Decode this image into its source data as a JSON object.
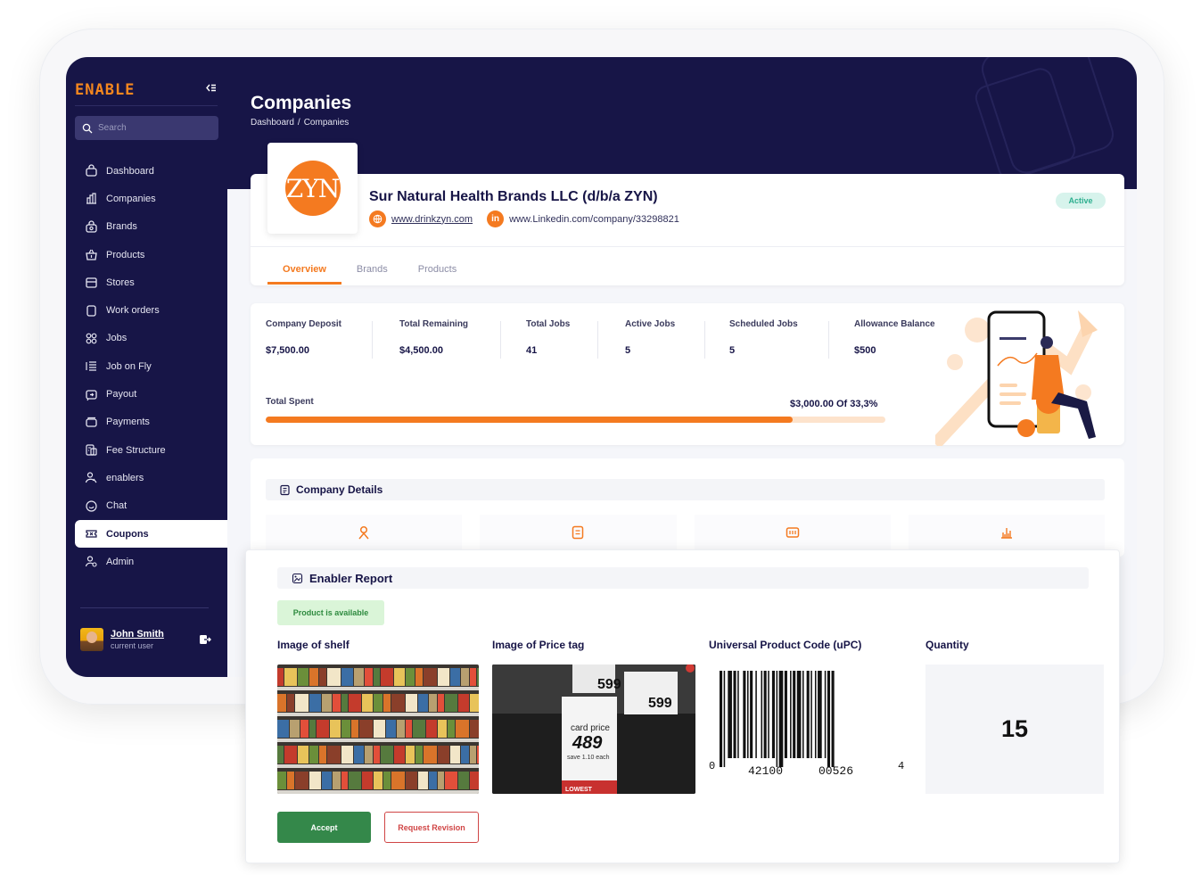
{
  "app": {
    "logo": "ENABLE"
  },
  "colors": {
    "navy": "#171547",
    "accent": "#f47a20",
    "success": "#34884a",
    "danger": "#d04545"
  },
  "search": {
    "placeholder": "Search"
  },
  "sidebar": {
    "items": [
      {
        "label": "Dashboard",
        "icon": "dashboard-icon"
      },
      {
        "label": "Companies",
        "icon": "companies-icon"
      },
      {
        "label": "Brands",
        "icon": "brands-icon"
      },
      {
        "label": "Products",
        "icon": "products-icon"
      },
      {
        "label": "Stores",
        "icon": "stores-icon"
      },
      {
        "label": "Work orders",
        "icon": "work-orders-icon"
      },
      {
        "label": "Jobs",
        "icon": "jobs-icon"
      },
      {
        "label": "Job on Fly",
        "icon": "job-on-fly-icon"
      },
      {
        "label": "Payout",
        "icon": "payout-icon"
      },
      {
        "label": "Payments",
        "icon": "payments-icon"
      },
      {
        "label": "Fee Structure",
        "icon": "fee-structure-icon"
      },
      {
        "label": "enablers",
        "icon": "enablers-icon"
      },
      {
        "label": "Chat",
        "icon": "chat-icon"
      },
      {
        "label": "Coupons",
        "icon": "coupons-icon",
        "active": true
      },
      {
        "label": "Admin",
        "icon": "admin-icon"
      }
    ],
    "user": {
      "name": "John Smith",
      "role": "current user"
    }
  },
  "header": {
    "title": "Companies",
    "breadcrumb": [
      "Dashboard",
      "/",
      "Companies"
    ]
  },
  "company": {
    "logo_text": "ZYN",
    "name": "Sur Natural Health Brands LLC (d/b/a ZYN)",
    "website": "www.drinkzyn.com",
    "linkedin": "www.Linkedin.com/company/33298821",
    "status": "Active",
    "tabs": [
      "Overview",
      "Brands",
      "Products"
    ]
  },
  "stats": [
    {
      "label": "Company Deposit",
      "value": "$7,500.00"
    },
    {
      "label": "Total Remaining",
      "value": "$4,500.00"
    },
    {
      "label": "Total Jobs",
      "value": "41"
    },
    {
      "label": "Active Jobs",
      "value": "5"
    },
    {
      "label": "Scheduled Jobs",
      "value": "5"
    },
    {
      "label": "Allowance Balance",
      "value": "$500"
    }
  ],
  "spent": {
    "label": "Total Spent",
    "value": "$3,000.00 Of 33,3%",
    "progress_fraction": 0.85
  },
  "details": {
    "title": "Company Details"
  },
  "report": {
    "title": "Enabler Report",
    "availability": "Product is available",
    "columns": [
      "Image of shelf",
      "Image of Price tag",
      "Universal Product Code (uPC)",
      "Quantity"
    ],
    "price_tag": {
      "price_a": "599",
      "price_b": "599",
      "card_price_label": "card price",
      "card_price": "489",
      "save": "save 1.10 each",
      "footer": "LOWEST"
    },
    "upc": {
      "left": "0",
      "group1": "42100",
      "group2": "00526",
      "right": "4"
    },
    "quantity": "15",
    "accept": "Accept",
    "revise": "Request Revision"
  }
}
